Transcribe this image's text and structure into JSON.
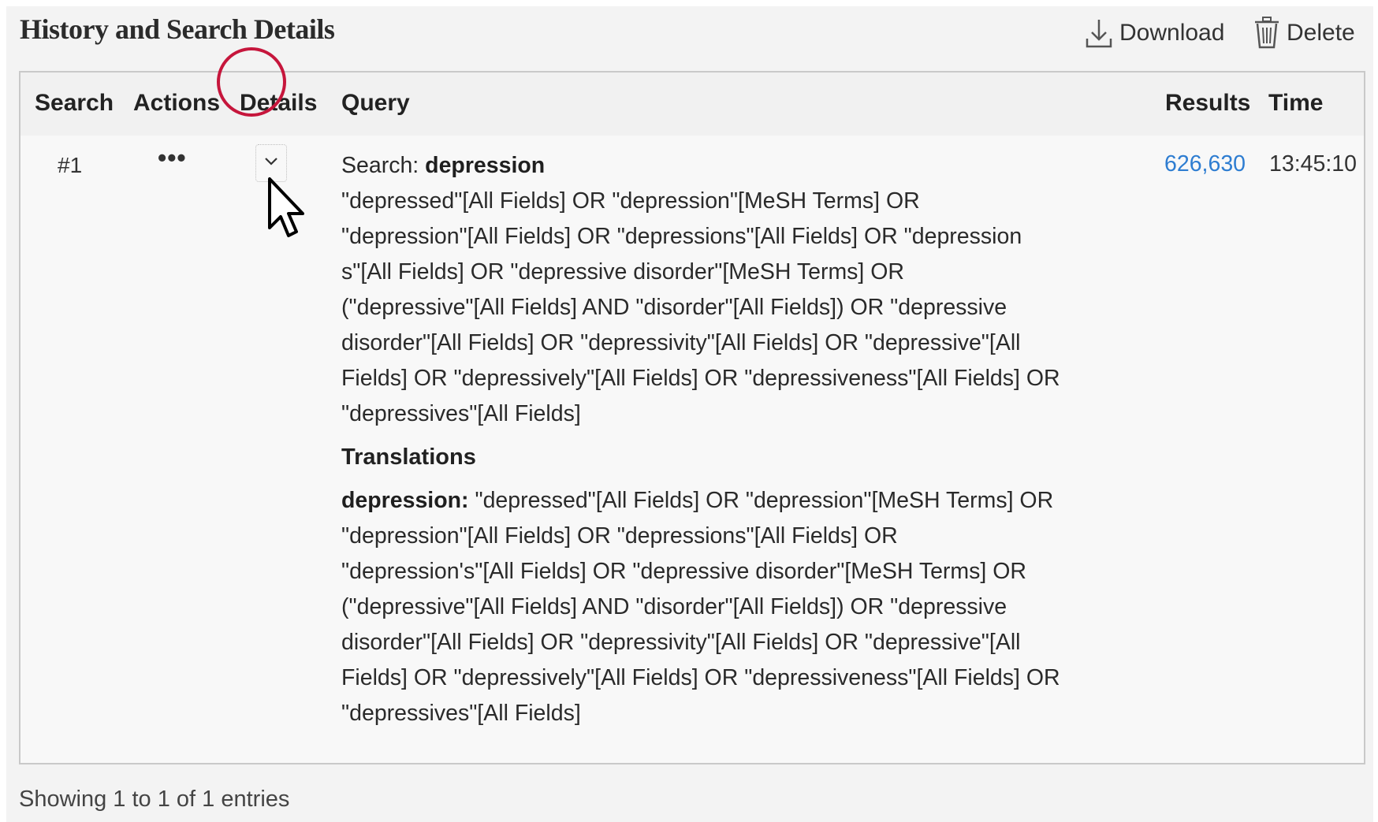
{
  "header": {
    "title": "History and Search Details",
    "download_label": "Download",
    "delete_label": "Delete"
  },
  "table": {
    "columns": [
      "Search",
      "Actions",
      "Details",
      "Query",
      "Results",
      "Time"
    ],
    "rows": [
      {
        "number": "#1",
        "actions": "•••",
        "query_prefix": "Search:",
        "query_term": "depression",
        "query_lines": [
          "\"depressed\"[All Fields] OR \"depression\"[MeSH Terms] OR",
          "\"depression\"[All Fields] OR \"depressions\"[All Fields] OR \"depression",
          "s\"[All Fields] OR \"depressive disorder\"[MeSH Terms] OR",
          "(\"depressive\"[All Fields] AND \"disorder\"[All Fields]) OR \"depressive",
          "disorder\"[All Fields] OR \"depressivity\"[All Fields] OR \"depressive\"[All",
          "Fields] OR \"depressively\"[All Fields] OR \"depressiveness\"[All Fields] OR",
          "\"depressives\"[All Fields]"
        ],
        "translations_title": "Translations",
        "translation_term": "depression:",
        "translation_first_line": " \"depressed\"[All Fields] OR \"depression\"[MeSH Terms] OR",
        "translation_lines": [
          "\"depression\"[All Fields] OR \"depressions\"[All Fields] OR",
          "\"depression's\"[All Fields] OR \"depressive disorder\"[MeSH Terms] OR",
          "(\"depressive\"[All Fields] AND \"disorder\"[All Fields]) OR \"depressive",
          "disorder\"[All Fields] OR \"depressivity\"[All Fields] OR \"depressive\"[All",
          "Fields] OR \"depressively\"[All Fields] OR \"depressiveness\"[All Fields] OR",
          "\"depressives\"[All Fields]"
        ],
        "results": "626,630",
        "time": "13:45:10"
      }
    ]
  },
  "footer": {
    "entries_text": "Showing 1 to 1 of 1 entries"
  },
  "colors": {
    "accent_link": "#2e7dd1",
    "highlight_circle": "#c6163c"
  },
  "icons": [
    "download-icon",
    "trash-icon",
    "chevron-down-icon",
    "mouse-cursor-icon"
  ]
}
